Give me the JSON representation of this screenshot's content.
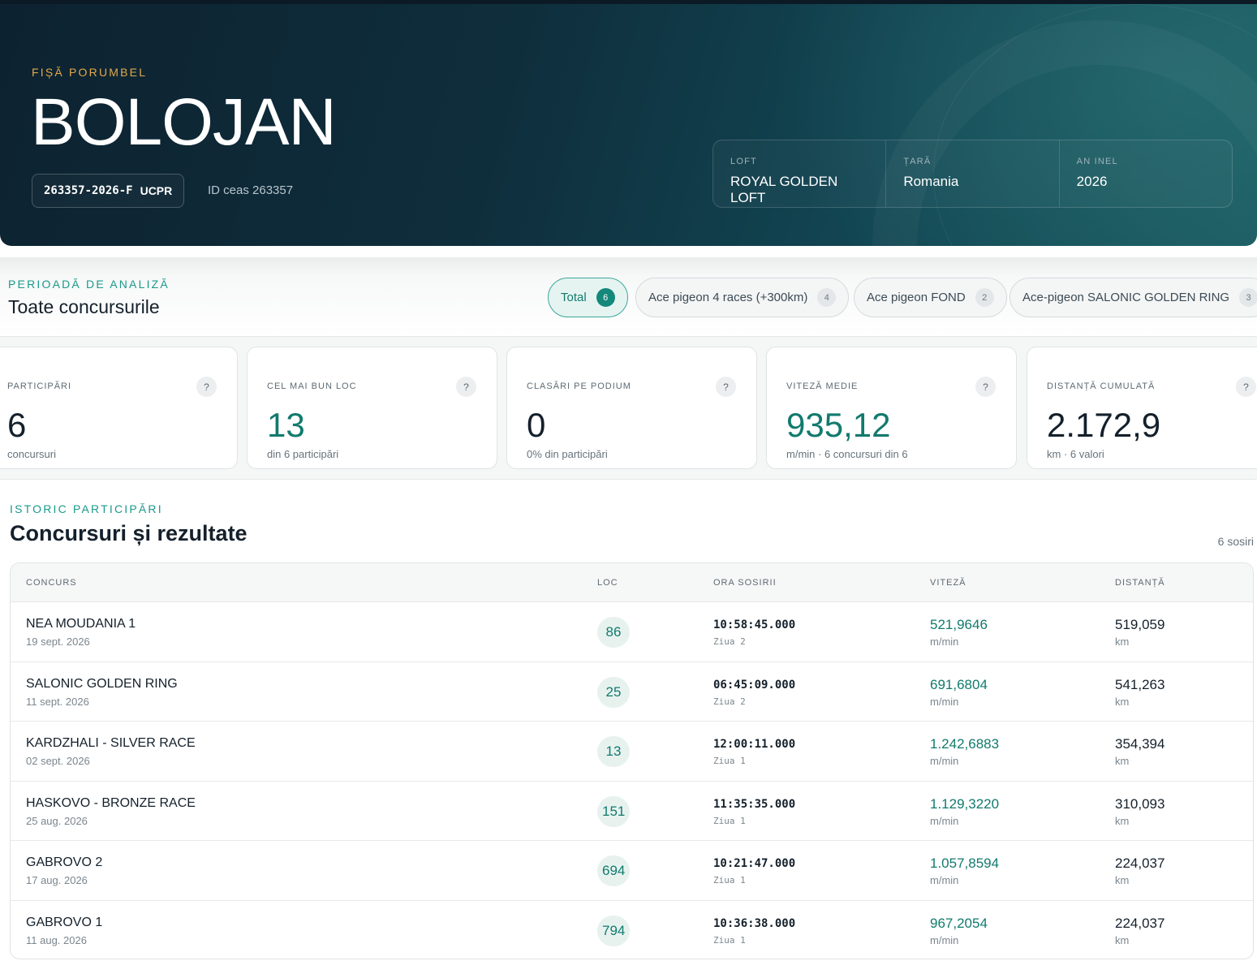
{
  "hero": {
    "eyebrow": "FIȘĂ PORUMBEL",
    "name": "BOLOJAN",
    "ring": "263357-2026-F",
    "org": "UCPR",
    "clock_id": "ID ceas 263357",
    "info": [
      {
        "label": "LOFT",
        "value": "ROYAL GOLDEN LOFT"
      },
      {
        "label": "ȚARĂ",
        "value": "Romania"
      },
      {
        "label": "AN INEL",
        "value": "2026"
      }
    ]
  },
  "period": {
    "eyebrow": "PERIOADĂ DE ANALIZĂ",
    "heading": "Toate concursurile",
    "filters": [
      {
        "label": "Total",
        "count": "6",
        "active": true
      },
      {
        "label": "Ace pigeon 4 races (+300km)",
        "count": "4",
        "active": false
      },
      {
        "label": "Ace pigeon FOND",
        "count": "2",
        "active": false
      },
      {
        "label": "Ace-pigeon SALONIC GOLDEN RING",
        "count": "3",
        "active": false
      }
    ]
  },
  "stats": [
    {
      "label": "PARTICIPĂRI",
      "help": "?",
      "value": "6",
      "sub": "concursuri",
      "accent": false
    },
    {
      "label": "CEL MAI BUN LOC",
      "help": "?",
      "value": "13",
      "sub": "din 6 participări",
      "accent": true
    },
    {
      "label": "CLASĂRI PE PODIUM",
      "help": "?",
      "value": "0",
      "sub": "0% din participări",
      "accent": false
    },
    {
      "label": "VITEZĂ MEDIE",
      "help": "?",
      "value": "935,12",
      "sub": "m/min · 6 concursuri din 6",
      "accent": true
    },
    {
      "label": "DISTANȚĂ CUMULATĂ",
      "help": "?",
      "value": "2.172,9",
      "sub": "km · 6 valori",
      "accent": false
    }
  ],
  "history": {
    "eyebrow": "ISTORIC PARTICIPĂRI",
    "title": "Concursuri și rezultate",
    "count": "6 sosiri",
    "columns": [
      "CONCURS",
      "LOC",
      "ORA SOSIRII",
      "VITEZĂ",
      "DISTANȚĂ"
    ],
    "rows": [
      {
        "name": "NEA MOUDANIA 1",
        "date": "19 sept. 2026",
        "loc": "86",
        "time": "10:58:45.000",
        "day": "Ziua 2",
        "speed": "521,9646",
        "speed_unit": "m/min",
        "dist": "519,059",
        "dist_unit": "km"
      },
      {
        "name": "SALONIC GOLDEN RING",
        "date": "11 sept. 2026",
        "loc": "25",
        "time": "06:45:09.000",
        "day": "Ziua 2",
        "speed": "691,6804",
        "speed_unit": "m/min",
        "dist": "541,263",
        "dist_unit": "km"
      },
      {
        "name": "KARDZHALI - SILVER RACE",
        "date": "02 sept. 2026",
        "loc": "13",
        "time": "12:00:11.000",
        "day": "Ziua 1",
        "speed": "1.242,6883",
        "speed_unit": "m/min",
        "dist": "354,394",
        "dist_unit": "km"
      },
      {
        "name": "HASKOVO - BRONZE RACE",
        "date": "25 aug. 2026",
        "loc": "151",
        "time": "11:35:35.000",
        "day": "Ziua 1",
        "speed": "1.129,3220",
        "speed_unit": "m/min",
        "dist": "310,093",
        "dist_unit": "km"
      },
      {
        "name": "GABROVO 2",
        "date": "17 aug. 2026",
        "loc": "694",
        "time": "10:21:47.000",
        "day": "Ziua 1",
        "speed": "1.057,8594",
        "speed_unit": "m/min",
        "dist": "224,037",
        "dist_unit": "km"
      },
      {
        "name": "GABROVO 1",
        "date": "11 aug. 2026",
        "loc": "794",
        "time": "10:36:38.000",
        "day": "Ziua 1",
        "speed": "967,2054",
        "speed_unit": "m/min",
        "dist": "224,037",
        "dist_unit": "km"
      }
    ]
  }
}
